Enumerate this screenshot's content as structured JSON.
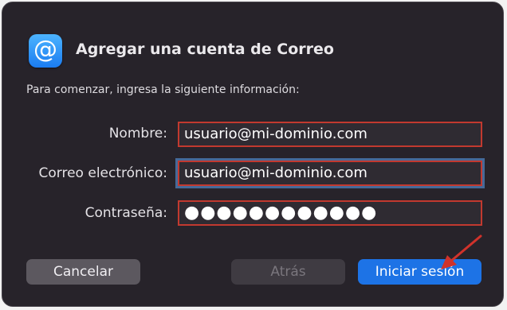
{
  "dialog": {
    "app_icon": "at-sign-icon",
    "app_icon_glyph": "@",
    "title": "Agregar una cuenta de Correo",
    "instructions": "Para comenzar, ingresa la siguiente información:"
  },
  "form": {
    "name_label": "Nombre:",
    "name_value": "usuario@mi-dominio.com",
    "email_label": "Correo electrónico:",
    "email_value": "usuario@mi-dominio.com",
    "password_label": "Contraseña:",
    "password_value": "●●●●●●●●●●●●"
  },
  "buttons": {
    "cancel_label": "Cancelar",
    "back_label": "Atrás",
    "signin_label": "Iniciar sesión"
  },
  "colors": {
    "dialog_background": "#27232a",
    "highlight_border": "#c2392f",
    "primary_button": "#1d73e6",
    "annotation_arrow": "#d0322b"
  },
  "annotation": {
    "icon": "red-arrow-icon"
  }
}
